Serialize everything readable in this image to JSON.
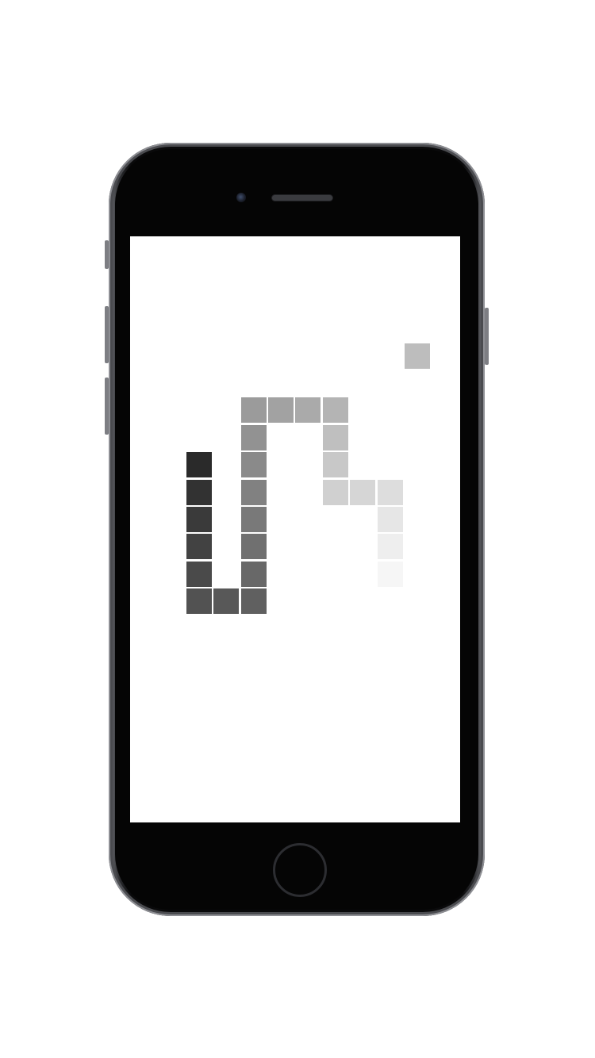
{
  "snake": {
    "segments": [
      {
        "col": 9,
        "row": 12,
        "color": "#f6f6f6"
      },
      {
        "col": 9,
        "row": 11,
        "color": "#eeeeee"
      },
      {
        "col": 9,
        "row": 10,
        "color": "#e6e6e6"
      },
      {
        "col": 9,
        "row": 9,
        "color": "#dddddd"
      },
      {
        "col": 8,
        "row": 9,
        "color": "#d6d6d6"
      },
      {
        "col": 7,
        "row": 9,
        "color": "#d0d0d0"
      },
      {
        "col": 7,
        "row": 8,
        "color": "#c8c8c8"
      },
      {
        "col": 7,
        "row": 7,
        "color": "#bfbfbf"
      },
      {
        "col": 7,
        "row": 6,
        "color": "#b4b4b4"
      },
      {
        "col": 6,
        "row": 6,
        "color": "#aaaaaa"
      },
      {
        "col": 5,
        "row": 6,
        "color": "#a2a2a2"
      },
      {
        "col": 4,
        "row": 6,
        "color": "#9b9b9b"
      },
      {
        "col": 4,
        "row": 7,
        "color": "#929292"
      },
      {
        "col": 4,
        "row": 8,
        "color": "#8a8a8a"
      },
      {
        "col": 4,
        "row": 9,
        "color": "#818181"
      },
      {
        "col": 4,
        "row": 10,
        "color": "#797979"
      },
      {
        "col": 4,
        "row": 11,
        "color": "#707070"
      },
      {
        "col": 4,
        "row": 12,
        "color": "#686868"
      },
      {
        "col": 4,
        "row": 13,
        "color": "#606060"
      },
      {
        "col": 3,
        "row": 13,
        "color": "#585858"
      },
      {
        "col": 2,
        "row": 13,
        "color": "#525252"
      },
      {
        "col": 2,
        "row": 12,
        "color": "#4a4a4a"
      },
      {
        "col": 2,
        "row": 11,
        "color": "#424242"
      },
      {
        "col": 2,
        "row": 10,
        "color": "#3a3a3a"
      },
      {
        "col": 2,
        "row": 9,
        "color": "#323232"
      },
      {
        "col": 2,
        "row": 8,
        "color": "#2a2a2a"
      }
    ]
  },
  "food": {
    "col": 10,
    "row": 4,
    "color": "#bdbdbd"
  },
  "colors": {
    "screen_background": "#ffffff",
    "device_body": "#0a0a0b",
    "device_frame": "#6f7075"
  }
}
